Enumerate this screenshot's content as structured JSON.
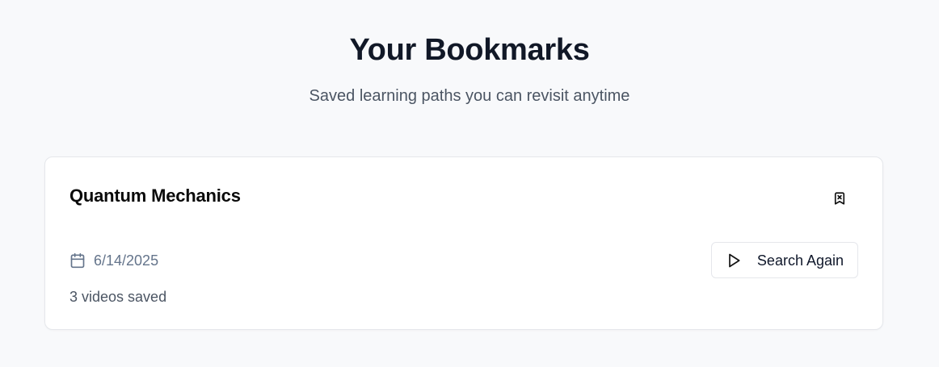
{
  "header": {
    "title": "Your Bookmarks",
    "subtitle": "Saved learning paths you can revisit anytime"
  },
  "bookmarks": [
    {
      "title": "Quantum Mechanics",
      "date": "6/14/2025",
      "videos_saved": "3 videos saved",
      "action_label": "Search Again",
      "icons": {
        "remove": "bookmark-x-icon",
        "date": "calendar-icon",
        "action": "play-icon"
      }
    }
  ],
  "colors": {
    "background": "#f8f9fb",
    "card": "#ffffff",
    "title": "#111827",
    "muted": "#64748b",
    "border": "#e5e7eb"
  }
}
